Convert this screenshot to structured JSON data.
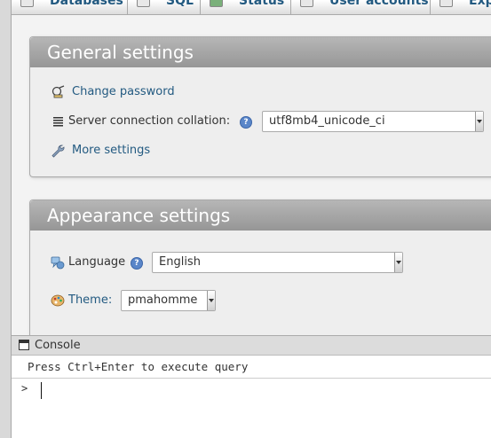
{
  "tabs": [
    {
      "label": "Databases",
      "icon": "database-icon"
    },
    {
      "label": "SQL",
      "icon": "sql-icon"
    },
    {
      "label": "Status",
      "icon": "status-icon"
    },
    {
      "label": "User accounts",
      "icon": "user-accounts-icon"
    },
    {
      "label": "Exp",
      "icon": "export-icon"
    }
  ],
  "general": {
    "title": "General settings",
    "change_password": "Change password",
    "collation_label": "Server connection collation:",
    "collation_value": "utf8mb4_unicode_ci",
    "more_settings": "More settings"
  },
  "appearance": {
    "title": "Appearance settings",
    "language_label": "Language",
    "language_value": "English",
    "theme_label": "Theme:",
    "theme_value": "pmahomme"
  },
  "console": {
    "title": "Console",
    "message": "Press Ctrl+Enter to execute query",
    "prompt": ">"
  },
  "help_glyph": "?",
  "colors": {
    "link": "#235a81",
    "group_header": "#a8a8a8",
    "help_icon": "#5a86c9"
  }
}
